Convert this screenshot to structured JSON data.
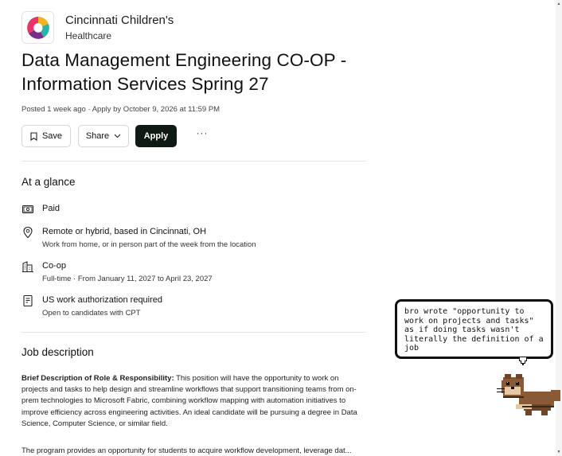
{
  "employer": {
    "name_line1": "Cincinnati Children's",
    "name_line2": "Healthcare",
    "logo_icon": "cincinnati-childrens-logo"
  },
  "job": {
    "title": "Data Management Engineering CO-OP - Information Services Spring 27",
    "posted": "Posted 1 week ago · Apply by October 9, 2026 at 11:59 PM"
  },
  "actions": {
    "save_label": "Save",
    "share_label": "Share",
    "apply_label": "Apply",
    "more_label": "···"
  },
  "glance": {
    "title": "At a glance",
    "items": [
      {
        "icon": "money-icon",
        "title": "Paid",
        "subtitle": ""
      },
      {
        "icon": "location-pin-icon",
        "title": "Remote or hybrid, based in Cincinnati, OH",
        "subtitle": "Work from home, or in person part of the week from the location"
      },
      {
        "icon": "building-icon",
        "title": "Co-op",
        "subtitle": "Full-time · From January 11, 2027 to April 23, 2027"
      },
      {
        "icon": "document-icon",
        "title": "US work authorization required",
        "subtitle": "Open to candidates with CPT"
      }
    ]
  },
  "description": {
    "title": "Job description",
    "lead_label": "Brief Description of Role & Responsibility:",
    "lead_text": " This position will have the opportunity to work on projects and tasks to help design and streamline workflows that support transitioning teams from on-prem technologies to Microsoft Fabric, combining workflow mapping with automation initiatives to improve efficiency across engineering activities.  An ideal candidate will be pursuing a degree in Data Science, Computer Science, or similar field.",
    "para2": "The program provides an opportunity for students to acquire workflow development, leverage dat..."
  },
  "overlay": {
    "speech_text": "bro wrote \"opportunity to work on projects and tasks\" as if doing tasks wasn't literally the definition of a job"
  },
  "colors": {
    "apply_bg": "#0f1a14",
    "divider": "#e6e6e6"
  }
}
